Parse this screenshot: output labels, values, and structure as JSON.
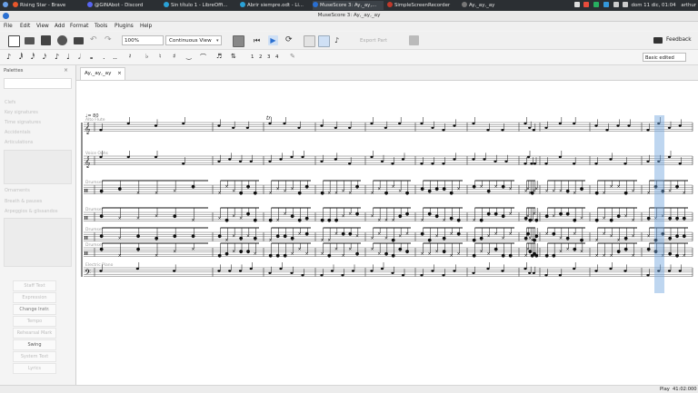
{
  "taskbar": {
    "items": [
      {
        "label": "Rising Star - Brave",
        "color": "#e8572b"
      },
      {
        "label": "@GINAbot - Discord",
        "color": "#5865f2"
      },
      {
        "label": "Sin título 1 - LibreOffi...",
        "color": "#2aa1d6"
      },
      {
        "label": "Abrir siempre.odt - Li...",
        "color": "#2aa1d6"
      },
      {
        "label": "MuseScore 3: Ay,_ay,...",
        "color": "#2a6fd1"
      },
      {
        "label": "SimpleScreenRecorder",
        "color": "#c0392b"
      },
      {
        "label": "Ay,_ay,_ay",
        "color": "#555555"
      }
    ],
    "clock": "dom 11 dic, 01:04",
    "user": "arthur"
  },
  "window_title": "MuseScore 3: Ay,_ay,_ay",
  "menu": [
    "File",
    "Edit",
    "View",
    "Add",
    "Format",
    "Tools",
    "Plugins",
    "Help"
  ],
  "toolbar": {
    "zoom_value": "100%",
    "view_mode": "Continuous View",
    "feedback_label": "Feedback"
  },
  "note_toolbar": {
    "voices": [
      "1",
      "2",
      "3",
      "4"
    ],
    "workspace": "Basic edited"
  },
  "palettes": {
    "title": "Palettes",
    "items": [
      "Clefs",
      "Key signatures",
      "Time signatures",
      "Accidentals",
      "Articulations",
      "Ornaments",
      "Breath & pauses",
      "Arpeggios & glissandos"
    ],
    "text_buttons": [
      "Staff Text",
      "Expression",
      "Change Instr.",
      "Tempo",
      "Rehearsal Mark",
      "Swing",
      "System Text",
      "Lyrics"
    ]
  },
  "score": {
    "tab_label": "Ay,_ay,_ay",
    "tempo_mark": "♩= 80",
    "trill": "tr",
    "instruments": [
      "Alto Flute",
      "Voice Oohs",
      "Drumset",
      "Drumset",
      "Drumset",
      "Drumset",
      "Electric Piano"
    ]
  },
  "status": {
    "mode": "Play",
    "time": "41:02:000"
  }
}
